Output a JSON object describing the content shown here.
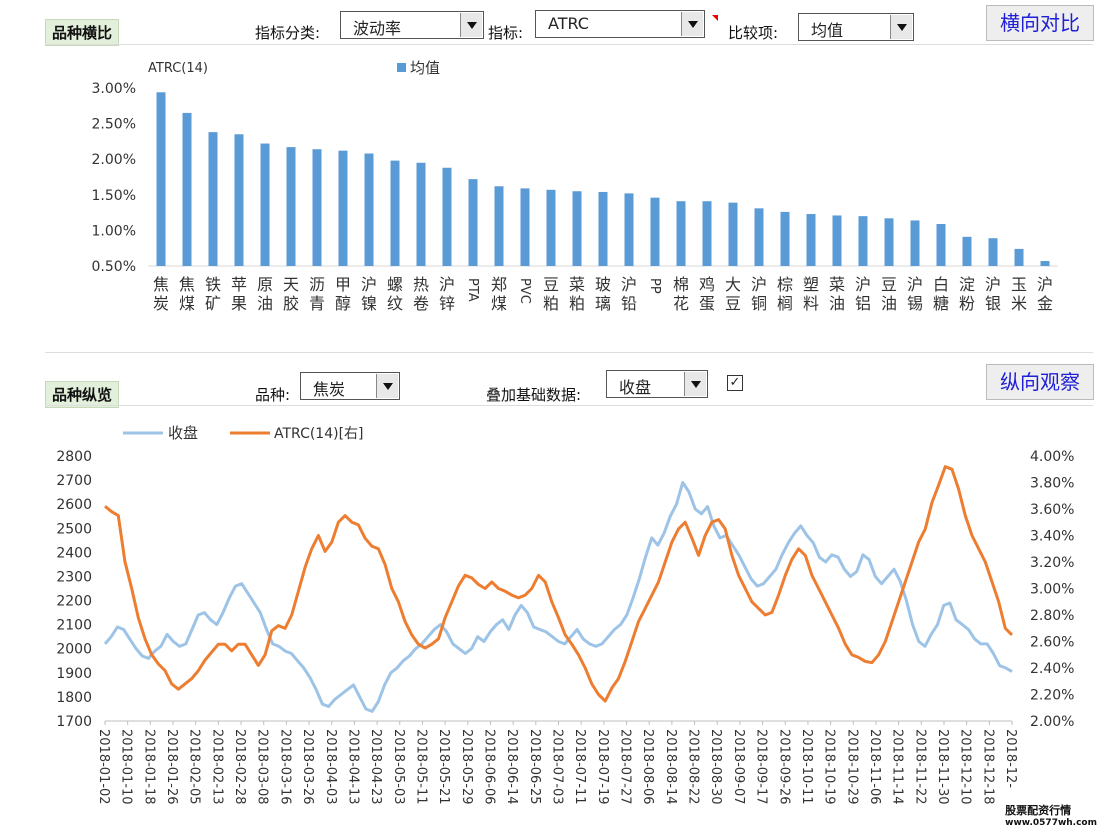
{
  "top": {
    "section_label": "品种横比",
    "category_label": "指标分类:",
    "category_value": "波动率",
    "indicator_label": "指标:",
    "indicator_value": "ATRC",
    "compare_label": "比较项:",
    "compare_value": "均值",
    "button_label": "横向对比"
  },
  "bottom": {
    "section_label": "品种纵览",
    "variety_label": "品种:",
    "variety_value": "焦炭",
    "overlay_label": "叠加基础数据:",
    "overlay_value": "收盘",
    "checkbox_mark": "✓",
    "button_label": "纵向观察"
  },
  "logo": {
    "name": "股票配资行情",
    "url": "www.0577wh.com"
  },
  "chart_data": [
    {
      "type": "bar",
      "title": "ATRC(14)",
      "legend": [
        "均值"
      ],
      "color": "#5b9bd5",
      "ylim": [
        0.005,
        0.03
      ],
      "yticks": [
        "0.50%",
        "1.00%",
        "1.50%",
        "2.00%",
        "2.50%",
        "3.00%"
      ],
      "categories": [
        "焦炭",
        "焦煤",
        "铁矿",
        "苹果",
        "原油",
        "天胶",
        "沥青",
        "甲醇",
        "沪镍",
        "螺纹",
        "热卷",
        "沪锌",
        "PTA",
        "郑煤",
        "PVC",
        "豆粕",
        "菜粕",
        "玻璃",
        "沪铅",
        "PP",
        "棉花",
        "鸡蛋",
        "大豆",
        "沪铜",
        "棕榈",
        "塑料",
        "菜油",
        "沪铝",
        "豆油",
        "沪锡",
        "白糖",
        "淀粉",
        "沪银",
        "玉米",
        "沪金"
      ],
      "values": [
        0.0294,
        0.0265,
        0.0238,
        0.0235,
        0.0222,
        0.0217,
        0.0214,
        0.0212,
        0.0208,
        0.0198,
        0.0195,
        0.0188,
        0.0172,
        0.0162,
        0.0159,
        0.0157,
        0.0155,
        0.0154,
        0.0152,
        0.0146,
        0.0141,
        0.0141,
        0.0139,
        0.0131,
        0.0126,
        0.0123,
        0.0121,
        0.012,
        0.0117,
        0.0114,
        0.0109,
        0.0091,
        0.0089,
        0.0074,
        0.0057
      ]
    },
    {
      "type": "line",
      "series": [
        {
          "name": "收盘",
          "color": "#9dc3e6",
          "axis": "left",
          "values": [
            2020,
            2050,
            2090,
            2080,
            2040,
            2000,
            1970,
            1960,
            1990,
            2010,
            2060,
            2030,
            2010,
            2020,
            2080,
            2140,
            2150,
            2120,
            2100,
            2150,
            2210,
            2260,
            2270,
            2230,
            2190,
            2150,
            2080,
            2020,
            2010,
            1990,
            1980,
            1950,
            1920,
            1880,
            1830,
            1770,
            1760,
            1790,
            1810,
            1830,
            1850,
            1800,
            1750,
            1740,
            1780,
            1850,
            1900,
            1920,
            1950,
            1970,
            2000,
            2020,
            2050,
            2080,
            2100,
            2070,
            2020,
            2000,
            1980,
            2000,
            2050,
            2030,
            2070,
            2100,
            2120,
            2080,
            2140,
            2180,
            2150,
            2090,
            2080,
            2070,
            2050,
            2030,
            2020,
            2050,
            2080,
            2040,
            2020,
            2010,
            2020,
            2050,
            2080,
            2100,
            2140,
            2210,
            2290,
            2380,
            2460,
            2430,
            2480,
            2550,
            2600,
            2690,
            2650,
            2580,
            2560,
            2590,
            2510,
            2460,
            2470,
            2430,
            2390,
            2340,
            2290,
            2260,
            2270,
            2300,
            2330,
            2390,
            2440,
            2480,
            2510,
            2470,
            2440,
            2380,
            2360,
            2390,
            2380,
            2330,
            2300,
            2320,
            2390,
            2370,
            2300,
            2270,
            2300,
            2330,
            2280,
            2200,
            2100,
            2030,
            2010,
            2060,
            2100,
            2180,
            2190,
            2120,
            2100,
            2080,
            2040,
            2020,
            2020,
            1980,
            1930,
            1920,
            1905
          ]
        },
        {
          "name": "ATRC(14)[右]",
          "color": "#ed7d31",
          "axis": "right",
          "values": [
            0.0362,
            0.0358,
            0.0355,
            0.032,
            0.03,
            0.0278,
            0.0262,
            0.025,
            0.0243,
            0.0238,
            0.0228,
            0.0224,
            0.0228,
            0.0232,
            0.0238,
            0.0246,
            0.0252,
            0.0258,
            0.0258,
            0.0253,
            0.0258,
            0.0258,
            0.025,
            0.0242,
            0.025,
            0.0268,
            0.0272,
            0.027,
            0.028,
            0.0298,
            0.0316,
            0.033,
            0.034,
            0.0328,
            0.0335,
            0.035,
            0.0355,
            0.035,
            0.0348,
            0.0338,
            0.0332,
            0.033,
            0.0318,
            0.03,
            0.029,
            0.0275,
            0.0265,
            0.0258,
            0.0255,
            0.0258,
            0.0262,
            0.0278,
            0.029,
            0.0302,
            0.031,
            0.0308,
            0.0303,
            0.03,
            0.0305,
            0.03,
            0.0298,
            0.0295,
            0.0293,
            0.0295,
            0.03,
            0.031,
            0.0305,
            0.029,
            0.0278,
            0.0265,
            0.0258,
            0.025,
            0.024,
            0.0228,
            0.022,
            0.0215,
            0.0225,
            0.0232,
            0.0245,
            0.026,
            0.0275,
            0.0285,
            0.0295,
            0.0305,
            0.032,
            0.0335,
            0.0345,
            0.035,
            0.0338,
            0.0325,
            0.034,
            0.035,
            0.0352,
            0.0345,
            0.0325,
            0.031,
            0.03,
            0.029,
            0.0285,
            0.028,
            0.0282,
            0.0295,
            0.031,
            0.0322,
            0.033,
            0.0325,
            0.031,
            0.03,
            0.029,
            0.028,
            0.027,
            0.0258,
            0.025,
            0.0248,
            0.0245,
            0.0244,
            0.025,
            0.026,
            0.0275,
            0.029,
            0.0305,
            0.032,
            0.0335,
            0.0345,
            0.0365,
            0.0378,
            0.0392,
            0.039,
            0.0375,
            0.0355,
            0.034,
            0.033,
            0.032,
            0.0305,
            0.029,
            0.027,
            0.0265
          ]
        }
      ],
      "legend": [
        "收盘",
        "ATRC(14)[右]"
      ],
      "ylim_left": [
        1700,
        2800
      ],
      "ylim_right": [
        0.02,
        0.04
      ],
      "yticks_left": [
        "1700",
        "1800",
        "1900",
        "2000",
        "2100",
        "2200",
        "2300",
        "2400",
        "2500",
        "2600",
        "2700",
        "2800"
      ],
      "yticks_right": [
        "2.00%",
        "2.20%",
        "2.40%",
        "2.60%",
        "2.80%",
        "3.00%",
        "3.20%",
        "3.40%",
        "3.60%",
        "3.80%",
        "4.00%"
      ],
      "x_ticks": [
        "2018-01-02",
        "2018-01-10",
        "2018-01-18",
        "2018-01-26",
        "2018-02-05",
        "2018-02-13",
        "2018-02-28",
        "2018-03-08",
        "2018-03-16",
        "2018-03-26",
        "2018-04-03",
        "2018-04-13",
        "2018-04-23",
        "2018-05-03",
        "2018-05-11",
        "2018-05-21",
        "2018-05-29",
        "2018-06-06",
        "2018-06-14",
        "2018-06-25",
        "2018-07-03",
        "2018-07-11",
        "2018-07-19",
        "2018-07-27",
        "2018-08-06",
        "2018-08-14",
        "2018-08-22",
        "2018-08-30",
        "2018-09-07",
        "2018-09-17",
        "2018-09-26",
        "2018-10-11",
        "2018-10-19",
        "2018-10-29",
        "2018-11-06",
        "2018-11-14",
        "2018-11-22",
        "2018-11-30",
        "2018-12-10",
        "2018-12-18",
        "2018-12-"
      ]
    }
  ]
}
